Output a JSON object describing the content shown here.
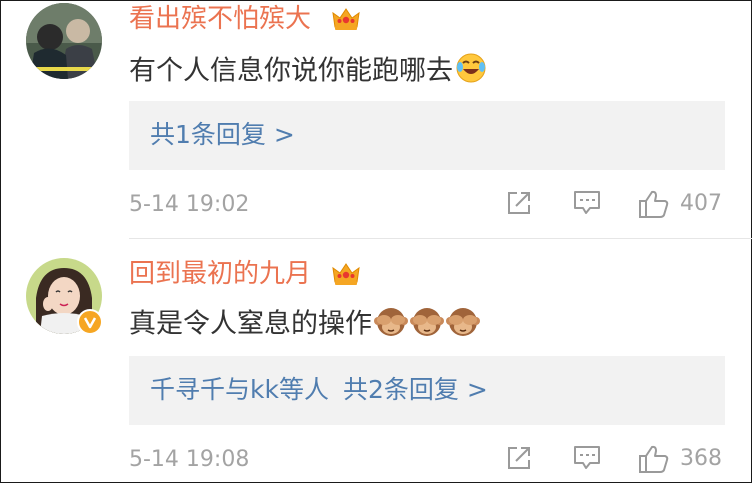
{
  "comments": [
    {
      "username": "看出殡不怕殡大",
      "text": "有个人信息你说你能跑哪去",
      "emoji": [
        "laugh-cry-emoji"
      ],
      "reply_names": "",
      "reply_summary": "共1条回复 >",
      "timestamp": "5-14 19:02",
      "likes": "407",
      "badge": "vip-crown"
    },
    {
      "username": "回到最初的九月",
      "text": "真是令人窒息的操作",
      "emoji": [
        "see-no-evil-monkey-emoji",
        "see-no-evil-monkey-emoji",
        "see-no-evil-monkey-emoji"
      ],
      "reply_names": "千寻千与kk等人",
      "reply_summary": "共2条回复 >",
      "timestamp": "5-14 19:08",
      "likes": "368",
      "badge": "vip-crown",
      "verified": true
    }
  ],
  "colors": {
    "username": "#eb7350",
    "reply_link": "#507daf",
    "meta": "#a3a3a3",
    "reply_bg": "#f2f2f2",
    "verified_badge": "#f6a623"
  },
  "icons": [
    "share-icon",
    "comment-icon",
    "like-icon"
  ]
}
